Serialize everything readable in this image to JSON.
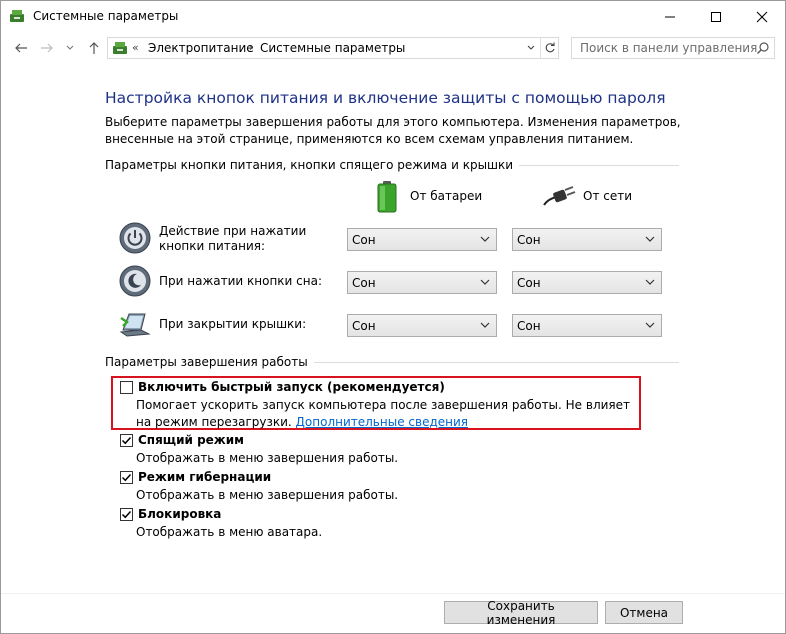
{
  "window": {
    "title": "Системные параметры"
  },
  "address": {
    "chevron": "«",
    "crumbs": [
      "Электропитание",
      "Системные параметры"
    ]
  },
  "search": {
    "placeholder": "Поиск в панели управления"
  },
  "page": {
    "heading": "Настройка кнопок питания и включение защиты с помощью пароля",
    "description": "Выберите параметры завершения работы для этого компьютера. Изменения параметров, внесенные на этой странице, применяются ко всем схемам управления питанием."
  },
  "power_group": {
    "title": "Параметры кнопки питания, кнопки спящего режима и крышки",
    "col_battery": "От батареи",
    "col_ac": "От сети",
    "rows": [
      {
        "label": "Действие при нажатии кнопки питания:",
        "battery": "Сон",
        "ac": "Сон"
      },
      {
        "label": "При нажатии кнопки сна:",
        "battery": "Сон",
        "ac": "Сон"
      },
      {
        "label": "При закрытии крышки:",
        "battery": "Сон",
        "ac": "Сон"
      }
    ]
  },
  "shutdown_group": {
    "title": "Параметры завершения работы",
    "items": [
      {
        "label": "Включить быстрый запуск (рекомендуется)",
        "checked": false,
        "desc": "Помогает ускорить запуск компьютера после завершения работы. Не влияет на режим перезагрузки.",
        "link": "Дополнительные сведения"
      },
      {
        "label": "Спящий режим",
        "checked": true,
        "desc": "Отображать в меню завершения работы."
      },
      {
        "label": "Режим гибернации",
        "checked": true,
        "desc": "Отображать в меню завершения работы."
      },
      {
        "label": "Блокировка",
        "checked": true,
        "desc": "Отображать в меню аватара."
      }
    ]
  },
  "buttons": {
    "save": "Сохранить изменения",
    "cancel": "Отмена"
  },
  "colors": {
    "heading": "#1e3287",
    "link": "#0066cc",
    "highlight": "#d9121f"
  }
}
